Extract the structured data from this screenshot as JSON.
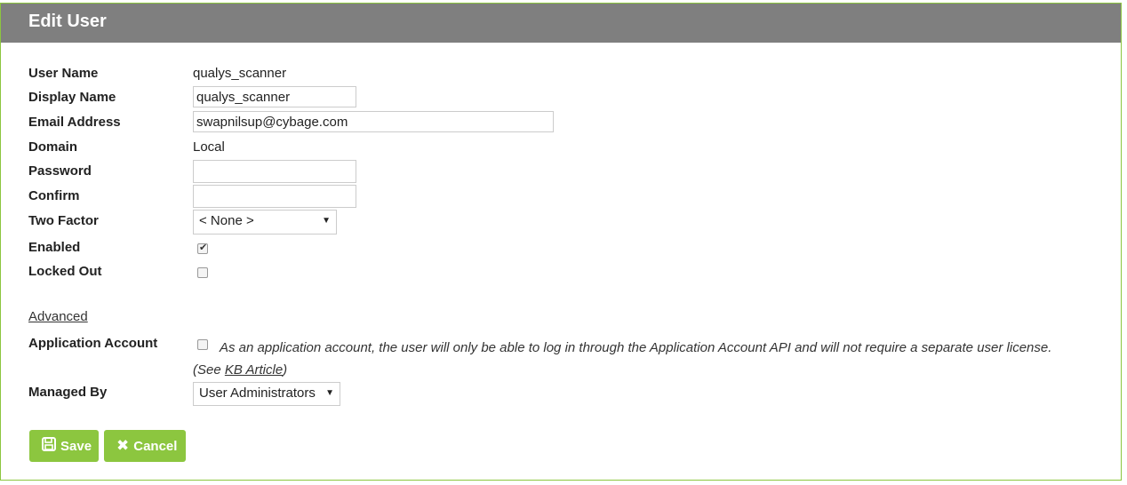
{
  "header": {
    "title": "Edit User"
  },
  "form": {
    "user_name": {
      "label": "User Name",
      "value": "qualys_scanner"
    },
    "display_name": {
      "label": "Display Name",
      "value": "qualys_scanner"
    },
    "email": {
      "label": "Email Address",
      "value": "swapnilsup@cybage.com"
    },
    "domain": {
      "label": "Domain",
      "value": "Local"
    },
    "password": {
      "label": "Password",
      "value": ""
    },
    "confirm": {
      "label": "Confirm",
      "value": ""
    },
    "two_factor": {
      "label": "Two Factor",
      "selected": "< None >"
    },
    "enabled": {
      "label": "Enabled",
      "checked": true
    },
    "locked_out": {
      "label": "Locked Out",
      "checked": false
    },
    "advanced_link": "Advanced",
    "application_account": {
      "label": "Application Account",
      "checked": false,
      "description": "As an application account, the user will only be able to log in through the Application Account API and will not require a separate user license. (See ",
      "kb_link": "KB Article",
      "description_end": ")"
    },
    "managed_by": {
      "label": "Managed By",
      "selected": "User Administrators"
    }
  },
  "buttons": {
    "save": "Save",
    "cancel": "Cancel"
  },
  "colors": {
    "header_bg": "#7f7f7f",
    "accent": "#8cc63f"
  }
}
